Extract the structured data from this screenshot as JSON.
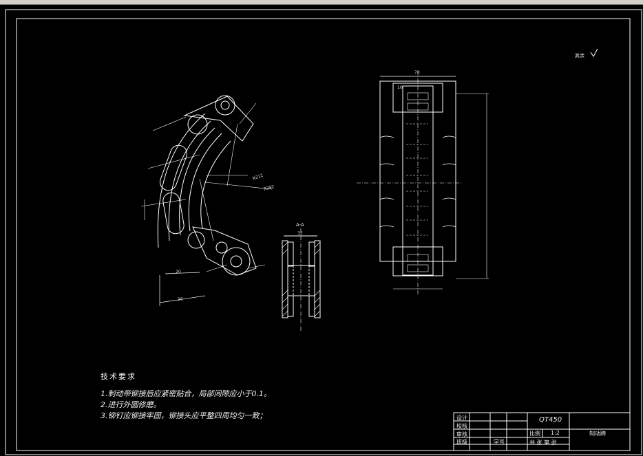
{
  "notes": {
    "title": "技术要求",
    "items": [
      "1.制动带铆接后应紧密贴合，局部间隙应小于0.1。",
      "2.进行外圆修磨。",
      "3.铆钉应铆接牢固，铆接头应平整四周均匀一致；"
    ]
  },
  "roughness": "其余",
  "section_label": "A-A",
  "dims": {
    "section_width": "35",
    "plan_width": "70",
    "plan_inner": "10",
    "len_25": "25",
    "len_20": "20",
    "r1": "R212",
    "r2": "R382"
  },
  "title_block": {
    "part_no": "QT450",
    "name": "制动蹄",
    "scale_label": "比例",
    "scale": "1:2",
    "rows": [
      "设计",
      "校核",
      "审核",
      "班级"
    ],
    "student_label": "学号",
    "sheets": "共  张  第  张"
  }
}
